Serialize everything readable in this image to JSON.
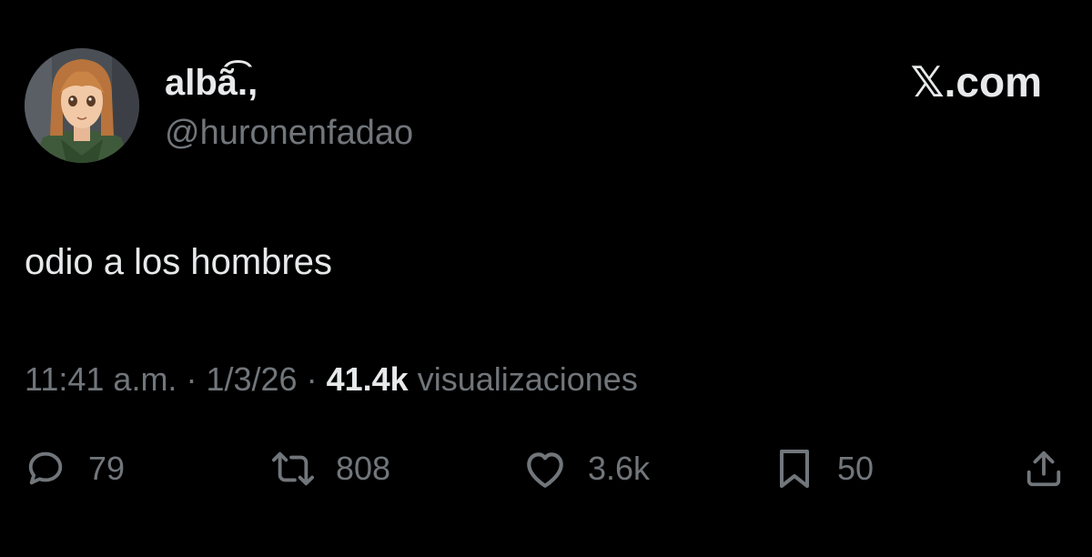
{
  "header": {
    "display_name": "albã͡.,",
    "handle": "@huronenfadao",
    "brand": "𝕏.com"
  },
  "tweet": {
    "text": "odio a los hombres"
  },
  "meta": {
    "time": "11:41 a.m.",
    "separator": "·",
    "date": "1/3/26",
    "views_count": "41.4k",
    "views_label": "visualizaciones"
  },
  "actions": {
    "replies": "79",
    "reposts": "808",
    "likes": "3.6k",
    "bookmarks": "50"
  },
  "icons": {
    "avatar": "anime-character-avatar",
    "reply": "speech-bubble-icon",
    "repost": "repost-arrows-icon",
    "like": "heart-icon",
    "bookmark": "bookmark-icon",
    "share": "share-upload-icon"
  },
  "colors": {
    "background": "#000000",
    "primary_text": "#e7e9ea",
    "secondary_text": "#71767b"
  }
}
